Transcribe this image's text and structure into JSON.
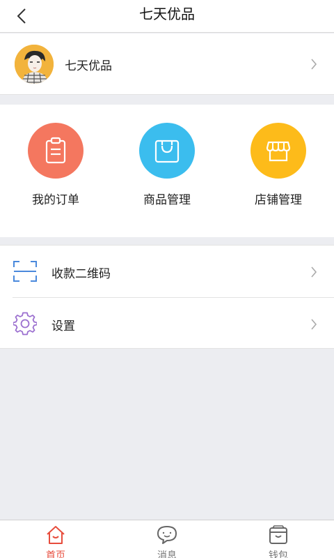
{
  "header": {
    "title": "七天优品",
    "back_icon": "chevron-left-icon"
  },
  "profile": {
    "name": "七天优品",
    "avatar_bg": "#f2b33c"
  },
  "shortcuts": [
    {
      "label": "我的订单",
      "icon": "clipboard-icon",
      "color": "#f4775f"
    },
    {
      "label": "商品管理",
      "icon": "shopping-bag-icon",
      "color": "#3bbdee"
    },
    {
      "label": "店铺管理",
      "icon": "storefront-icon",
      "color": "#fdbb1a"
    }
  ],
  "menu": [
    {
      "label": "收款二维码",
      "icon": "qr-scan-icon",
      "icon_color": "#4a89dc"
    },
    {
      "label": "设置",
      "icon": "gear-icon",
      "icon_color": "#9b6fcf"
    }
  ],
  "tabbar": [
    {
      "label": "首页",
      "icon": "home-icon",
      "active": true
    },
    {
      "label": "消息",
      "icon": "chat-bubble-icon",
      "active": false
    },
    {
      "label": "钱包",
      "icon": "wallet-icon",
      "active": false
    }
  ],
  "colors": {
    "accent": "#e74c3c",
    "background": "#ecedf1"
  }
}
